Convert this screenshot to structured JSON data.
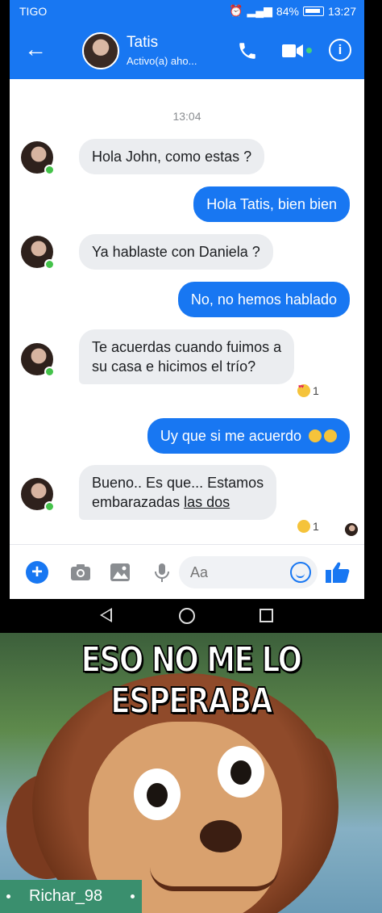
{
  "status_bar": {
    "carrier": "TIGO",
    "battery": "84%",
    "time": "13:27"
  },
  "header": {
    "contact_name": "Tatis",
    "contact_status": "Activo(a) aho..."
  },
  "chat": {
    "timestamp": "13:04",
    "messages": [
      {
        "direction": "in",
        "text": "Hola John, como estas ?"
      },
      {
        "direction": "out",
        "text": "Hola Tatis, bien bien"
      },
      {
        "direction": "in",
        "text": "Ya hablaste con Daniela ?"
      },
      {
        "direction": "out",
        "text": "No, no hemos hablado"
      },
      {
        "direction": "in",
        "line1": "Te acuerdas cuando fuimos a",
        "line2": "su casa e hicimos el trío?",
        "reaction_emoji": "heart-eyes-emoji",
        "reaction_count": "1"
      },
      {
        "direction": "out",
        "text": "Uy que si me acuerdo",
        "emojis": [
          "grin-sweat-emoji",
          "smirk-emoji"
        ]
      },
      {
        "direction": "in",
        "line1": "Bueno.. Es que... Estamos",
        "line2_plain": "embarazadas ",
        "line2_underlined": "las dos",
        "reaction_emoji": "sad-emoji",
        "reaction_count": "1"
      }
    ]
  },
  "composer": {
    "placeholder": "Aa"
  },
  "meme": {
    "caption": "ESO NO ME LO ESPERABA",
    "watermark": "Richar_98"
  },
  "colors": {
    "messenger_blue": "#1877f2",
    "incoming_bubble": "#ebedf0",
    "online_green": "#44c24a"
  }
}
